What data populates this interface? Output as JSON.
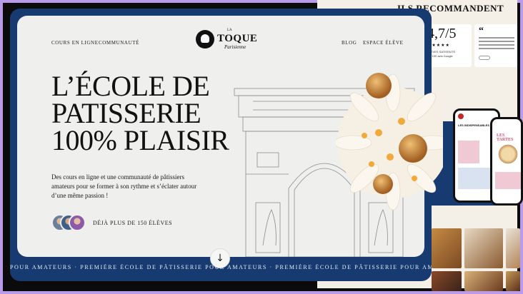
{
  "nav": {
    "left": [
      "COURS EN LIGNE",
      "COMMUNAUTÉ"
    ],
    "right": [
      "BLOG",
      "ESPACE ÉLÈVE"
    ]
  },
  "logo": {
    "small": "LA",
    "main": "TOQUE",
    "script": "Parisienne"
  },
  "hero": {
    "headline": [
      "L’ÉCOLE DE",
      "PATISSERIE",
      "100% PLAISIR"
    ],
    "description": "Des cours en ligne et une communauté de pâtissiers amateurs  pour se former à son rythme et s’éclater autour d’une même passion !",
    "students": "DÉJÀ PLUS DE 150 ÉLÈVES"
  },
  "marquee": "POUR AMATEURS · PREMIÈRE ÉCOLE DE PÂTISSERIE POUR AMATEURS · PREMIÈRE ÉCOLE DE PÂTISSERIE POUR AMATEURS · PREMIÈRE ÉCOLE DE PÂTISSERIE POUR AMATEURS",
  "side": {
    "reco_title": "ILS RECOMMANDENT",
    "rating": "4,7/5",
    "stars": "★★★★★",
    "rating_caption": "ÉLÈVES SATISFAITS",
    "rating_source": "sur 100 avis Google",
    "quote_mark": "“",
    "phone1_title": "LES INDISPENSABLES",
    "phone2_title": "LES TARTES"
  },
  "colors": {
    "navy": "#173a70",
    "cream": "#efefee",
    "lavender": "#b99be8"
  },
  "icons": {
    "down": "arrow-down-icon",
    "logo": "chef-hat-icon"
  }
}
